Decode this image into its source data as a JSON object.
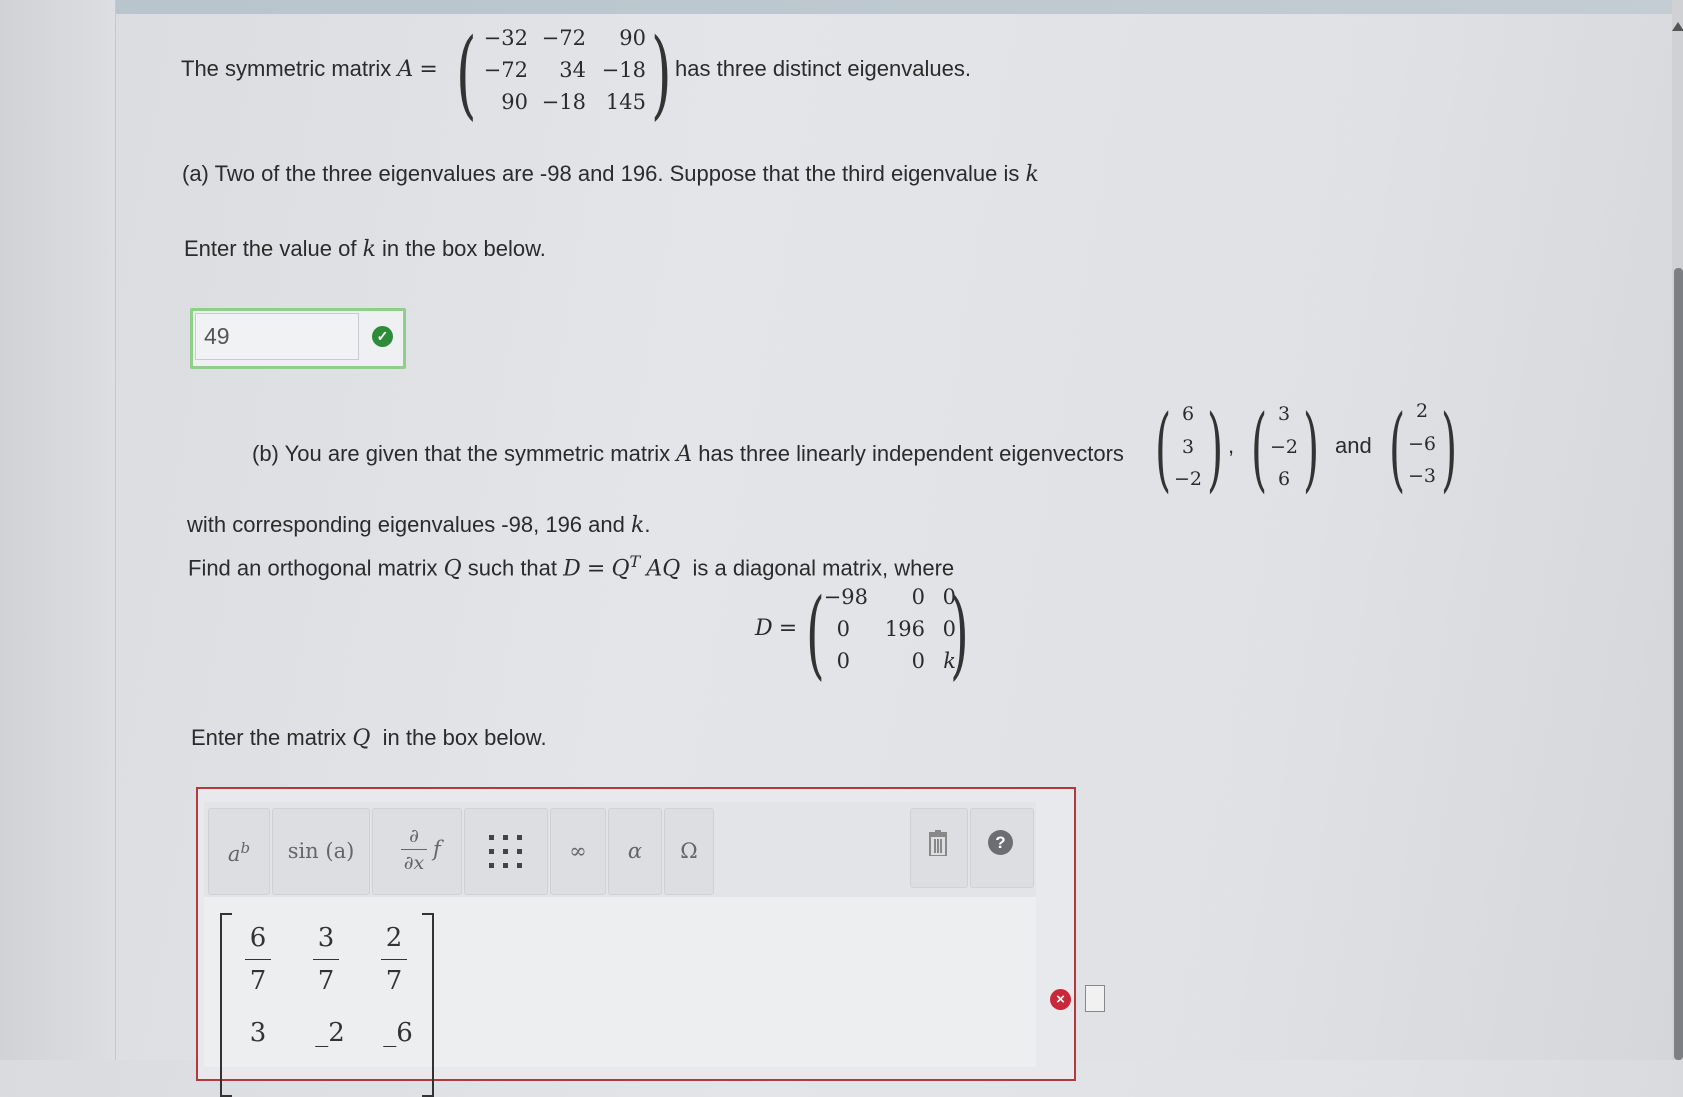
{
  "intro": {
    "prefix": "The symmetric matrix ",
    "var": "A",
    "eq": "=",
    "suffix": "has three distinct eigenvalues.",
    "matrix_A": [
      [
        "−32",
        "−72",
        "90"
      ],
      [
        "−72",
        "34",
        "−18"
      ],
      [
        "90",
        "−18",
        "145"
      ]
    ]
  },
  "part_a": {
    "statement": "(a) Two of the three eigenvalues are -98 and 196. Suppose that the third eigenvalue is ",
    "k": "k",
    "prompt_pre": "Enter the value of ",
    "prompt_post": " in the box below.",
    "answer_value": "49"
  },
  "part_b": {
    "statement_pre": "(b) You are given that the symmetric matrix ",
    "A": "A",
    "statement_post": " has three linearly independent eigenvectors",
    "v1": [
      "6",
      "3",
      "−2"
    ],
    "v2": [
      "3",
      "−2",
      "6"
    ],
    "v3": [
      "2",
      "−6",
      "−3"
    ],
    "comma": ",",
    "and": "and",
    "line2_pre": "with corresponding eigenvalues -98, 196 and ",
    "line2_k": "k",
    "line2_post": ".",
    "line3_pre": "Find an orthogonal matrix ",
    "Q": "Q",
    "line3_mid": " such that ",
    "eq_D": "D",
    "eq_equals": "=",
    "eq_Q": "Q",
    "eq_T": "T",
    "eq_AQ": "AQ",
    "line3_post": "is a diagonal matrix, where",
    "D_label": "D",
    "D_eq": "=",
    "matrix_D": [
      [
        "−98",
        "0",
        "0"
      ],
      [
        "0",
        "196",
        "0"
      ],
      [
        "0",
        "0",
        "k"
      ]
    ],
    "enter_pre": "Enter the matrix ",
    "enter_Q": "Q",
    "enter_post": "in the box below."
  },
  "toolbar": {
    "power_base": "a",
    "power_exp": "b",
    "trig": "sin (a)",
    "partial_num": "∂",
    "partial_den": "∂x",
    "partial_f": "f",
    "infinity": "∞",
    "alpha": "α",
    "omega": "Ω",
    "help": "?"
  },
  "answer_matrix": {
    "row1": [
      {
        "num": "6",
        "den": "7"
      },
      {
        "num": "3",
        "den": "7"
      },
      {
        "num": "2",
        "den": "7"
      }
    ],
    "row2": [
      "3",
      "_2",
      "_6"
    ]
  },
  "status": {
    "error": "×",
    "correct": "✓"
  }
}
